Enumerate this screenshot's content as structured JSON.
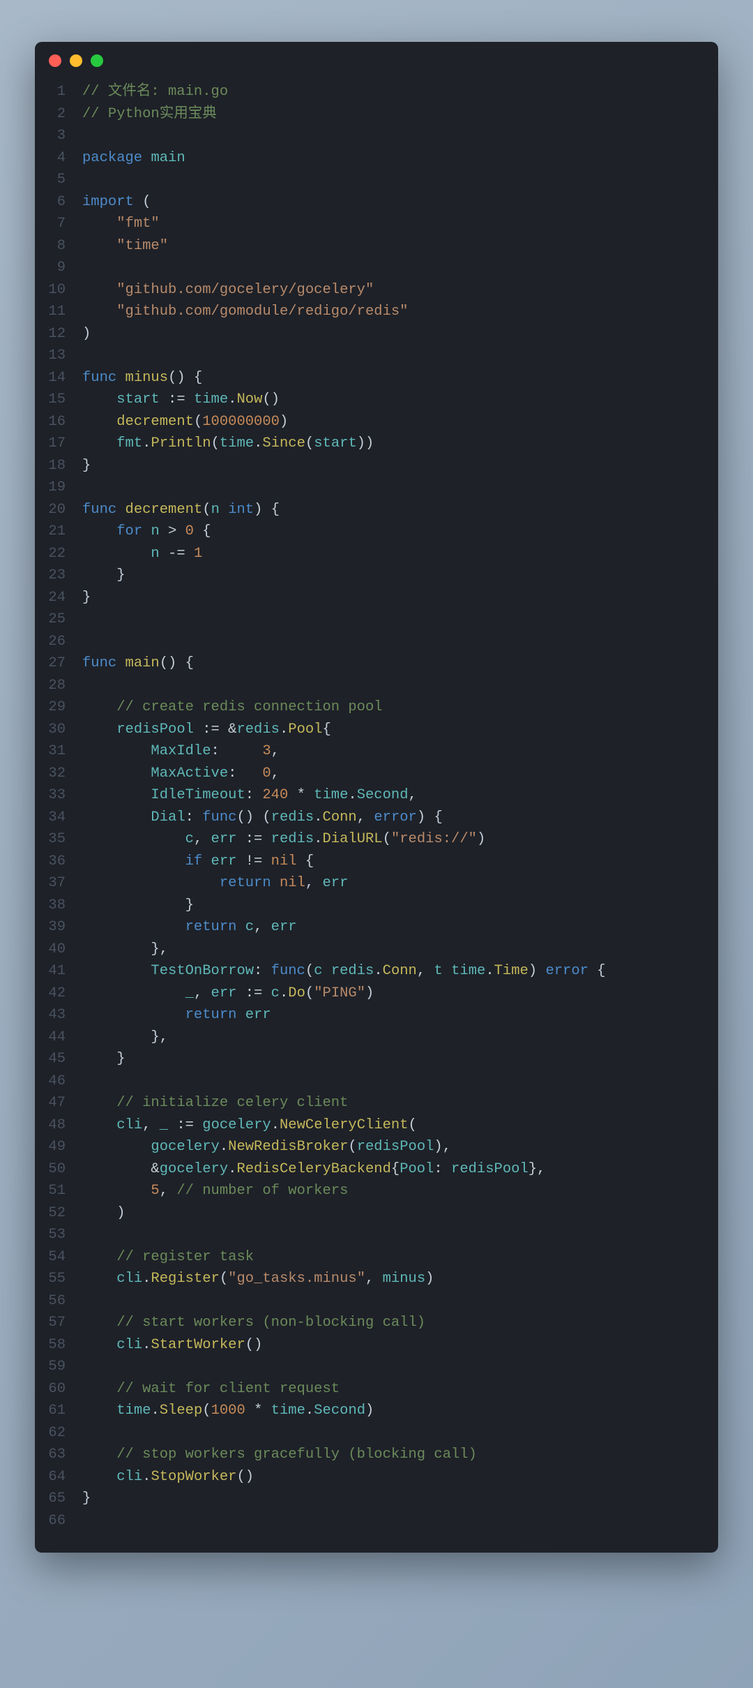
{
  "window": {
    "dots": [
      "red",
      "yellow",
      "green"
    ]
  },
  "code": {
    "lines": [
      {
        "n": "1",
        "t": [
          [
            "c-comment",
            "// 文件名: main.go"
          ]
        ]
      },
      {
        "n": "2",
        "t": [
          [
            "c-comment",
            "// Python实用宝典"
          ]
        ]
      },
      {
        "n": "3",
        "t": []
      },
      {
        "n": "4",
        "t": [
          [
            "c-keyword",
            "package"
          ],
          [
            "",
            " "
          ],
          [
            "c-ident",
            "main"
          ]
        ]
      },
      {
        "n": "5",
        "t": []
      },
      {
        "n": "6",
        "t": [
          [
            "c-keyword",
            "import"
          ],
          [
            "",
            " ("
          ]
        ]
      },
      {
        "n": "7",
        "t": [
          [
            "",
            "    "
          ],
          [
            "c-string",
            "\"fmt\""
          ]
        ]
      },
      {
        "n": "8",
        "t": [
          [
            "",
            "    "
          ],
          [
            "c-string",
            "\"time\""
          ]
        ]
      },
      {
        "n": "9",
        "t": []
      },
      {
        "n": "10",
        "t": [
          [
            "",
            "    "
          ],
          [
            "c-string",
            "\"github.com/gocelery/gocelery\""
          ]
        ]
      },
      {
        "n": "11",
        "t": [
          [
            "",
            "    "
          ],
          [
            "c-string",
            "\"github.com/gomodule/redigo/redis\""
          ]
        ]
      },
      {
        "n": "12",
        "t": [
          [
            "",
            ")"
          ]
        ]
      },
      {
        "n": "13",
        "t": []
      },
      {
        "n": "14",
        "t": [
          [
            "c-keyword",
            "func"
          ],
          [
            "",
            " "
          ],
          [
            "c-func",
            "minus"
          ],
          [
            "",
            "() {"
          ]
        ]
      },
      {
        "n": "15",
        "t": [
          [
            "",
            "    "
          ],
          [
            "c-ident",
            "start"
          ],
          [
            "",
            " := "
          ],
          [
            "c-ident",
            "time"
          ],
          [
            "",
            "."
          ],
          [
            "c-func",
            "Now"
          ],
          [
            "",
            "()"
          ]
        ]
      },
      {
        "n": "16",
        "t": [
          [
            "",
            "    "
          ],
          [
            "c-func",
            "decrement"
          ],
          [
            "",
            "("
          ],
          [
            "c-number",
            "100000000"
          ],
          [
            "",
            ")"
          ]
        ]
      },
      {
        "n": "17",
        "t": [
          [
            "",
            "    "
          ],
          [
            "c-ident",
            "fmt"
          ],
          [
            "",
            "."
          ],
          [
            "c-func",
            "Println"
          ],
          [
            "",
            "("
          ],
          [
            "c-ident",
            "time"
          ],
          [
            "",
            "."
          ],
          [
            "c-func",
            "Since"
          ],
          [
            "",
            "("
          ],
          [
            "c-ident",
            "start"
          ],
          [
            "",
            "))"
          ]
        ]
      },
      {
        "n": "18",
        "t": [
          [
            "",
            "}"
          ]
        ]
      },
      {
        "n": "19",
        "t": []
      },
      {
        "n": "20",
        "t": [
          [
            "c-keyword",
            "func"
          ],
          [
            "",
            " "
          ],
          [
            "c-func",
            "decrement"
          ],
          [
            "",
            "("
          ],
          [
            "c-ident",
            "n"
          ],
          [
            "",
            " "
          ],
          [
            "c-builtin",
            "int"
          ],
          [
            "",
            ") {"
          ]
        ]
      },
      {
        "n": "21",
        "t": [
          [
            "",
            "    "
          ],
          [
            "c-keyword",
            "for"
          ],
          [
            "",
            " "
          ],
          [
            "c-ident",
            "n"
          ],
          [
            "",
            " > "
          ],
          [
            "c-number",
            "0"
          ],
          [
            "",
            " {"
          ]
        ]
      },
      {
        "n": "22",
        "t": [
          [
            "",
            "        "
          ],
          [
            "c-ident",
            "n"
          ],
          [
            "",
            " -= "
          ],
          [
            "c-number",
            "1"
          ]
        ]
      },
      {
        "n": "23",
        "t": [
          [
            "",
            "    }"
          ]
        ]
      },
      {
        "n": "24",
        "t": [
          [
            "",
            "}"
          ]
        ]
      },
      {
        "n": "25",
        "t": []
      },
      {
        "n": "26",
        "t": []
      },
      {
        "n": "27",
        "t": [
          [
            "c-keyword",
            "func"
          ],
          [
            "",
            " "
          ],
          [
            "c-func",
            "main"
          ],
          [
            "",
            "() {"
          ]
        ]
      },
      {
        "n": "28",
        "t": []
      },
      {
        "n": "29",
        "t": [
          [
            "",
            "    "
          ],
          [
            "c-comment",
            "// create redis connection pool"
          ]
        ]
      },
      {
        "n": "30",
        "t": [
          [
            "",
            "    "
          ],
          [
            "c-ident",
            "redisPool"
          ],
          [
            "",
            " := &"
          ],
          [
            "c-ident",
            "redis"
          ],
          [
            "",
            "."
          ],
          [
            "c-type",
            "Pool"
          ],
          [
            "",
            "{"
          ]
        ]
      },
      {
        "n": "31",
        "t": [
          [
            "",
            "        "
          ],
          [
            "c-ident",
            "MaxIdle"
          ],
          [
            "",
            ":     "
          ],
          [
            "c-number",
            "3"
          ],
          [
            "",
            ","
          ]
        ]
      },
      {
        "n": "32",
        "t": [
          [
            "",
            "        "
          ],
          [
            "c-ident",
            "MaxActive"
          ],
          [
            "",
            ":   "
          ],
          [
            "c-number",
            "0"
          ],
          [
            "",
            ","
          ]
        ]
      },
      {
        "n": "33",
        "t": [
          [
            "",
            "        "
          ],
          [
            "c-ident",
            "IdleTimeout"
          ],
          [
            "",
            ": "
          ],
          [
            "c-number",
            "240"
          ],
          [
            "",
            " * "
          ],
          [
            "c-ident",
            "time"
          ],
          [
            "",
            "."
          ],
          [
            "c-ident",
            "Second"
          ],
          [
            "",
            ","
          ]
        ]
      },
      {
        "n": "34",
        "t": [
          [
            "",
            "        "
          ],
          [
            "c-ident",
            "Dial"
          ],
          [
            "",
            ": "
          ],
          [
            "c-keyword",
            "func"
          ],
          [
            "",
            "() ("
          ],
          [
            "c-ident",
            "redis"
          ],
          [
            "",
            "."
          ],
          [
            "c-type",
            "Conn"
          ],
          [
            "",
            ", "
          ],
          [
            "c-builtin",
            "error"
          ],
          [
            "",
            ") {"
          ]
        ]
      },
      {
        "n": "35",
        "t": [
          [
            "",
            "            "
          ],
          [
            "c-ident",
            "c"
          ],
          [
            "",
            ", "
          ],
          [
            "c-ident",
            "err"
          ],
          [
            "",
            " := "
          ],
          [
            "c-ident",
            "redis"
          ],
          [
            "",
            "."
          ],
          [
            "c-func",
            "DialURL"
          ],
          [
            "",
            "("
          ],
          [
            "c-string",
            "\"redis://\""
          ],
          [
            "",
            ")"
          ]
        ]
      },
      {
        "n": "36",
        "t": [
          [
            "",
            "            "
          ],
          [
            "c-keyword",
            "if"
          ],
          [
            "",
            " "
          ],
          [
            "c-ident",
            "err"
          ],
          [
            "",
            " != "
          ],
          [
            "c-const",
            "nil"
          ],
          [
            "",
            " {"
          ]
        ]
      },
      {
        "n": "37",
        "t": [
          [
            "",
            "                "
          ],
          [
            "c-keyword",
            "return"
          ],
          [
            "",
            " "
          ],
          [
            "c-const",
            "nil"
          ],
          [
            "",
            ", "
          ],
          [
            "c-ident",
            "err"
          ]
        ]
      },
      {
        "n": "38",
        "t": [
          [
            "",
            "            }"
          ]
        ]
      },
      {
        "n": "39",
        "t": [
          [
            "",
            "            "
          ],
          [
            "c-keyword",
            "return"
          ],
          [
            "",
            " "
          ],
          [
            "c-ident",
            "c"
          ],
          [
            "",
            ", "
          ],
          [
            "c-ident",
            "err"
          ]
        ]
      },
      {
        "n": "40",
        "t": [
          [
            "",
            "        },"
          ]
        ]
      },
      {
        "n": "41",
        "t": [
          [
            "",
            "        "
          ],
          [
            "c-ident",
            "TestOnBorrow"
          ],
          [
            "",
            ": "
          ],
          [
            "c-keyword",
            "func"
          ],
          [
            "",
            "("
          ],
          [
            "c-ident",
            "c"
          ],
          [
            "",
            " "
          ],
          [
            "c-ident",
            "redis"
          ],
          [
            "",
            "."
          ],
          [
            "c-type",
            "Conn"
          ],
          [
            "",
            ", "
          ],
          [
            "c-ident",
            "t"
          ],
          [
            "",
            " "
          ],
          [
            "c-ident",
            "time"
          ],
          [
            "",
            "."
          ],
          [
            "c-type",
            "Time"
          ],
          [
            "",
            ") "
          ],
          [
            "c-builtin",
            "error"
          ],
          [
            "",
            " {"
          ]
        ]
      },
      {
        "n": "42",
        "t": [
          [
            "",
            "            "
          ],
          [
            "c-ident",
            "_"
          ],
          [
            "",
            ", "
          ],
          [
            "c-ident",
            "err"
          ],
          [
            "",
            " := "
          ],
          [
            "c-ident",
            "c"
          ],
          [
            "",
            "."
          ],
          [
            "c-func",
            "Do"
          ],
          [
            "",
            "("
          ],
          [
            "c-string",
            "\"PING\""
          ],
          [
            "",
            ")"
          ]
        ]
      },
      {
        "n": "43",
        "t": [
          [
            "",
            "            "
          ],
          [
            "c-keyword",
            "return"
          ],
          [
            "",
            " "
          ],
          [
            "c-ident",
            "err"
          ]
        ]
      },
      {
        "n": "44",
        "t": [
          [
            "",
            "        },"
          ]
        ]
      },
      {
        "n": "45",
        "t": [
          [
            "",
            "    }"
          ]
        ]
      },
      {
        "n": "46",
        "t": []
      },
      {
        "n": "47",
        "t": [
          [
            "",
            "    "
          ],
          [
            "c-comment",
            "// initialize celery client"
          ]
        ]
      },
      {
        "n": "48",
        "t": [
          [
            "",
            "    "
          ],
          [
            "c-ident",
            "cli"
          ],
          [
            "",
            ", "
          ],
          [
            "c-ident",
            "_"
          ],
          [
            "",
            " := "
          ],
          [
            "c-ident",
            "gocelery"
          ],
          [
            "",
            "."
          ],
          [
            "c-func",
            "NewCeleryClient"
          ],
          [
            "",
            "("
          ]
        ]
      },
      {
        "n": "49",
        "t": [
          [
            "",
            "        "
          ],
          [
            "c-ident",
            "gocelery"
          ],
          [
            "",
            "."
          ],
          [
            "c-func",
            "NewRedisBroker"
          ],
          [
            "",
            "("
          ],
          [
            "c-ident",
            "redisPool"
          ],
          [
            "",
            "),"
          ]
        ]
      },
      {
        "n": "50",
        "t": [
          [
            "",
            "        &"
          ],
          [
            "c-ident",
            "gocelery"
          ],
          [
            "",
            "."
          ],
          [
            "c-type",
            "RedisCeleryBackend"
          ],
          [
            "",
            "{"
          ],
          [
            "c-ident",
            "Pool"
          ],
          [
            "",
            ": "
          ],
          [
            "c-ident",
            "redisPool"
          ],
          [
            "",
            "},"
          ]
        ]
      },
      {
        "n": "51",
        "t": [
          [
            "",
            "        "
          ],
          [
            "c-number",
            "5"
          ],
          [
            "",
            ", "
          ],
          [
            "c-comment",
            "// number of workers"
          ]
        ]
      },
      {
        "n": "52",
        "t": [
          [
            "",
            "    )"
          ]
        ]
      },
      {
        "n": "53",
        "t": []
      },
      {
        "n": "54",
        "t": [
          [
            "",
            "    "
          ],
          [
            "c-comment",
            "// register task"
          ]
        ]
      },
      {
        "n": "55",
        "t": [
          [
            "",
            "    "
          ],
          [
            "c-ident",
            "cli"
          ],
          [
            "",
            "."
          ],
          [
            "c-func",
            "Register"
          ],
          [
            "",
            "("
          ],
          [
            "c-string",
            "\"go_tasks.minus\""
          ],
          [
            "",
            ", "
          ],
          [
            "c-ident",
            "minus"
          ],
          [
            "",
            ")"
          ]
        ]
      },
      {
        "n": "56",
        "t": []
      },
      {
        "n": "57",
        "t": [
          [
            "",
            "    "
          ],
          [
            "c-comment",
            "// start workers (non-blocking call)"
          ]
        ]
      },
      {
        "n": "58",
        "t": [
          [
            "",
            "    "
          ],
          [
            "c-ident",
            "cli"
          ],
          [
            "",
            "."
          ],
          [
            "c-func",
            "StartWorker"
          ],
          [
            "",
            "()"
          ]
        ]
      },
      {
        "n": "59",
        "t": []
      },
      {
        "n": "60",
        "t": [
          [
            "",
            "    "
          ],
          [
            "c-comment",
            "// wait for client request"
          ]
        ]
      },
      {
        "n": "61",
        "t": [
          [
            "",
            "    "
          ],
          [
            "c-ident",
            "time"
          ],
          [
            "",
            "."
          ],
          [
            "c-func",
            "Sleep"
          ],
          [
            "",
            "("
          ],
          [
            "c-number",
            "1000"
          ],
          [
            "",
            " * "
          ],
          [
            "c-ident",
            "time"
          ],
          [
            "",
            "."
          ],
          [
            "c-ident",
            "Second"
          ],
          [
            "",
            ")"
          ]
        ]
      },
      {
        "n": "62",
        "t": []
      },
      {
        "n": "63",
        "t": [
          [
            "",
            "    "
          ],
          [
            "c-comment",
            "// stop workers gracefully (blocking call)"
          ]
        ]
      },
      {
        "n": "64",
        "t": [
          [
            "",
            "    "
          ],
          [
            "c-ident",
            "cli"
          ],
          [
            "",
            "."
          ],
          [
            "c-func",
            "StopWorker"
          ],
          [
            "",
            "()"
          ]
        ]
      },
      {
        "n": "65",
        "t": [
          [
            "",
            "}"
          ]
        ]
      },
      {
        "n": "66",
        "t": []
      }
    ]
  }
}
